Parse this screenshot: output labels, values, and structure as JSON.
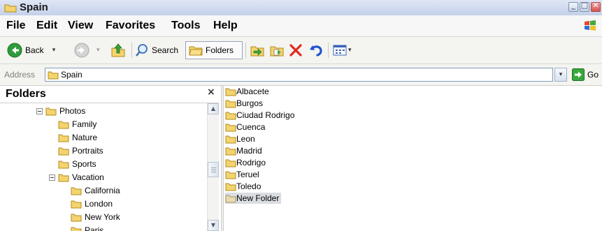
{
  "window": {
    "title": "Spain",
    "min_glyph": "_",
    "max_glyph": "□",
    "close_glyph": "✕"
  },
  "menu": [
    "File",
    "Edit",
    "View",
    "Favorites",
    "Tools",
    "Help"
  ],
  "toolbar": {
    "back_label": "Back",
    "search_label": "Search",
    "folders_label": "Folders",
    "caret": "▾"
  },
  "address": {
    "label": "Address",
    "value": "Spain",
    "go_label": "Go",
    "dropdown_glyph": "▾"
  },
  "folders_pane": {
    "title": "Folders",
    "close_glyph": "×",
    "scroll_up_glyph": "▲",
    "scroll_down_glyph": "▼"
  },
  "tree": [
    {
      "label": "Photos",
      "depth": 0,
      "expanded": true
    },
    {
      "label": "Family",
      "depth": 1
    },
    {
      "label": "Nature",
      "depth": 1
    },
    {
      "label": "Portraits",
      "depth": 1
    },
    {
      "label": "Sports",
      "depth": 1
    },
    {
      "label": "Vacation",
      "depth": 1,
      "expanded": true
    },
    {
      "label": "California",
      "depth": 2
    },
    {
      "label": "London",
      "depth": 2
    },
    {
      "label": "New York",
      "depth": 2
    },
    {
      "label": "Paris",
      "depth": 2
    }
  ],
  "files": [
    {
      "name": "Albacete"
    },
    {
      "name": "Burgos"
    },
    {
      "name": "Ciudad Rodrigo"
    },
    {
      "name": "Cuenca"
    },
    {
      "name": "Leon"
    },
    {
      "name": "Madrid"
    },
    {
      "name": "Rodrigo"
    },
    {
      "name": "Teruel"
    },
    {
      "name": "Toledo"
    },
    {
      "name": "New Folder",
      "selected": true
    }
  ],
  "colors": {
    "folder_fill": "#f3d46e",
    "folder_stroke": "#b58a1c",
    "selection": "#dadde2",
    "back_green": "#2e9c3a",
    "delete_red": "#e02a1e",
    "undo_blue": "#2255cc"
  },
  "icons": [
    "folder-icon",
    "back-arrow-icon",
    "forward-arrow-icon",
    "up-folder-icon",
    "search-icon",
    "move-to-icon",
    "copy-to-icon",
    "delete-icon",
    "undo-icon",
    "views-icon",
    "go-arrow-icon",
    "windows-logo-icon"
  ]
}
